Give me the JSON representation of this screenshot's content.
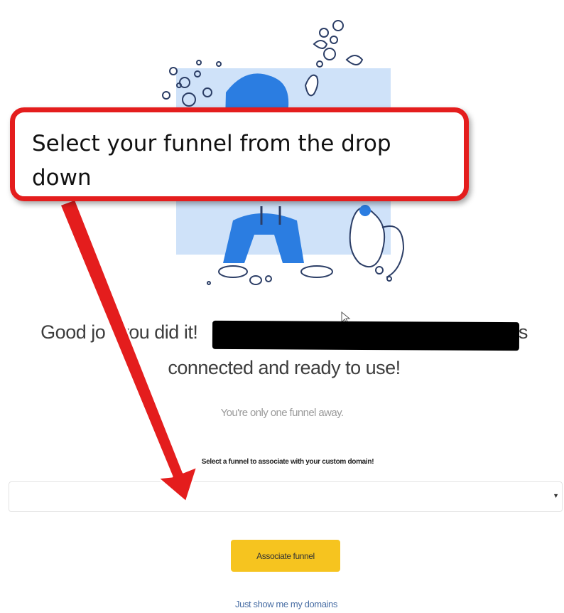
{
  "illustration": {
    "icon": "hiker-and-squirrel-illustration",
    "colors": {
      "blue": "#2b7de1",
      "light_blue": "#cfe2f9",
      "line": "#2c3e66"
    }
  },
  "headline": {
    "part1": "Good jo",
    "part2": "you did it!",
    "part3": "is",
    "line2": "connected and ready to use!"
  },
  "subtext": "You're only one funnel away.",
  "funnel_select": {
    "label": "Select a funnel to associate with your custom domain!",
    "value": ""
  },
  "associate_button": "Associate funnel",
  "domains_link": "Just show me my domains",
  "callout": {
    "text": "Select your funnel from the drop down",
    "border_color": "#e41d1d"
  },
  "accent_color": "#f6c41f"
}
